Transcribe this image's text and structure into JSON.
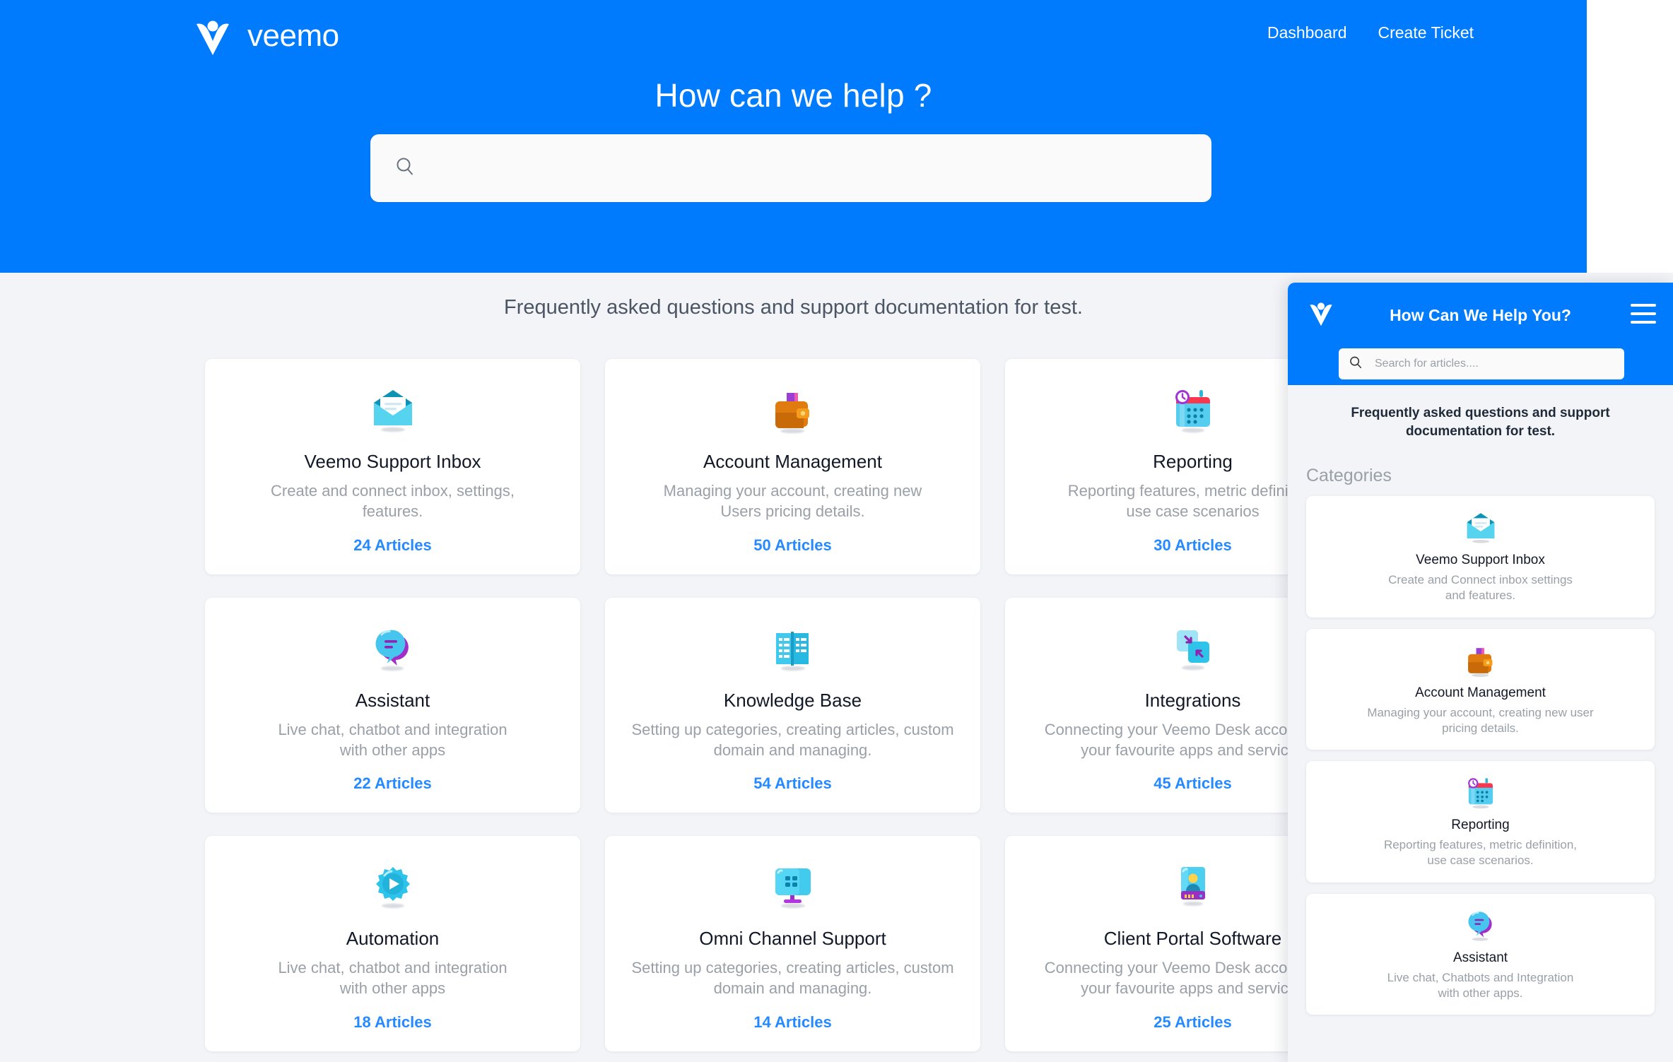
{
  "brand": {
    "name": "veemo",
    "logo_icon": "veemo-v-person-logo"
  },
  "nav": {
    "links": [
      {
        "label": "Dashboard"
      },
      {
        "label": "Create Ticket"
      }
    ]
  },
  "hero": {
    "title": "How can we help ?",
    "search": {
      "value": "",
      "placeholder": "",
      "icon": "search-icon"
    },
    "background_color": "#007bfe"
  },
  "main": {
    "subtitle": "Frequently asked questions and support documentation for test.",
    "background_color": "#f2f4f8",
    "accent_color": "#2589ff",
    "cards": [
      {
        "icon": "open-envelope-icon",
        "title": "Veemo Support Inbox",
        "desc": "Create and connect inbox, settings,\nfeatures.",
        "count": "24 Articles"
      },
      {
        "icon": "wallet-icon",
        "title": "Account Management",
        "desc": "Managing your account, creating new\nUsers pricing details.",
        "count": "50 Articles"
      },
      {
        "icon": "calendar-clock-icon",
        "title": "Reporting",
        "desc": "Reporting features, metric definition,\nuse case scenarios",
        "count": "30 Articles"
      },
      {
        "icon": "chat-bubbles-icon",
        "title": "Assistant",
        "desc": "Live chat, chatbot and integration\nwith other apps",
        "count": "22 Articles"
      },
      {
        "icon": "open-book-icon",
        "title": "Knowledge Base",
        "desc": "Setting up categories, creating articles, custom\ndomain and managing.",
        "count": "54 Articles"
      },
      {
        "icon": "two-squares-arrows-icon",
        "title": "Integrations",
        "desc": "Connecting your Veemo Desk account with\nyour favourite apps and services",
        "count": "45 Articles"
      },
      {
        "icon": "gear-play-icon",
        "title": "Automation",
        "desc": "Live chat, chatbot and integration\nwith other apps",
        "count": "18 Articles"
      },
      {
        "icon": "monitor-icon",
        "title": "Omni Channel Support",
        "desc": "Setting up categories, creating articles, custom\ndomain and managing.",
        "count": "14 Articles"
      },
      {
        "icon": "id-card-icon",
        "title": "Client Portal Software",
        "desc": "Connecting your Veemo Desk account with\nyour favourite apps and services",
        "count": "25 Articles"
      }
    ]
  },
  "widget": {
    "logo_icon": "veemo-v-person-logo",
    "title": "How Can We Help You?",
    "menu_icon": "hamburger-menu-icon",
    "search": {
      "value": "",
      "placeholder": "Search for articles....",
      "icon": "search-icon"
    },
    "subtitle": "Frequently asked questions and support documentation for test.",
    "categories_label": "Categories",
    "cards": [
      {
        "icon": "open-envelope-icon",
        "title": "Veemo Support Inbox",
        "desc": "Create and Connect inbox settings\nand features."
      },
      {
        "icon": "wallet-icon",
        "title": "Account Management",
        "desc": "Managing your account, creating new user\npricing details."
      },
      {
        "icon": "calendar-clock-icon",
        "title": "Reporting",
        "desc": "Reporting features, metric definition,\nuse case scenarios."
      },
      {
        "icon": "chat-bubbles-icon",
        "title": "Assistant",
        "desc": "Live chat, Chatbots and Integration\nwith other apps."
      }
    ]
  }
}
